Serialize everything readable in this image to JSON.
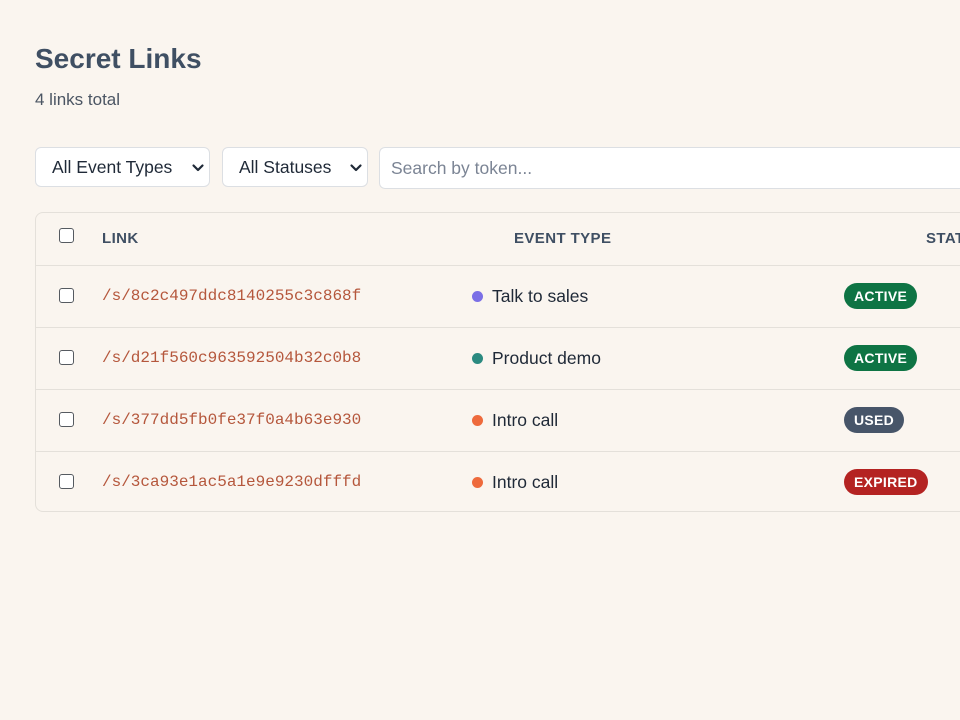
{
  "page": {
    "title": "Secret Links",
    "subtitle": "4 links total"
  },
  "filters": {
    "event_type": "All Event Types",
    "status": "All Statuses",
    "search_placeholder": "Search by token..."
  },
  "table": {
    "columns": {
      "link": "LINK",
      "event_type": "EVENT TYPE",
      "status": "STATUS"
    },
    "rows": [
      {
        "link": "/s/8c2c497ddc8140255c3c868f",
        "event_type": "Talk to sales",
        "event_color": "#7b6fe6",
        "status": "ACTIVE",
        "status_color": "#0e7444"
      },
      {
        "link": "/s/d21f560c963592504b32c0b8",
        "event_type": "Product demo",
        "event_color": "#2b8a80",
        "status": "ACTIVE",
        "status_color": "#0e7444"
      },
      {
        "link": "/s/377dd5fb0fe37f0a4b63e930",
        "event_type": "Intro call",
        "event_color": "#ee6a3c",
        "status": "USED",
        "status_color": "#475569"
      },
      {
        "link": "/s/3ca93e1ac5a1e9e9230dfffd",
        "event_type": "Intro call",
        "event_color": "#ee6a3c",
        "status": "EXPIRED",
        "status_color": "#b42322"
      }
    ]
  },
  "colors": {
    "background": "#faf5ef",
    "link_text": "#b5573c",
    "heading": "#3f4f63"
  },
  "icons": {
    "select_caret": "chevron-down-icon",
    "event_marker": "dot-icon"
  }
}
